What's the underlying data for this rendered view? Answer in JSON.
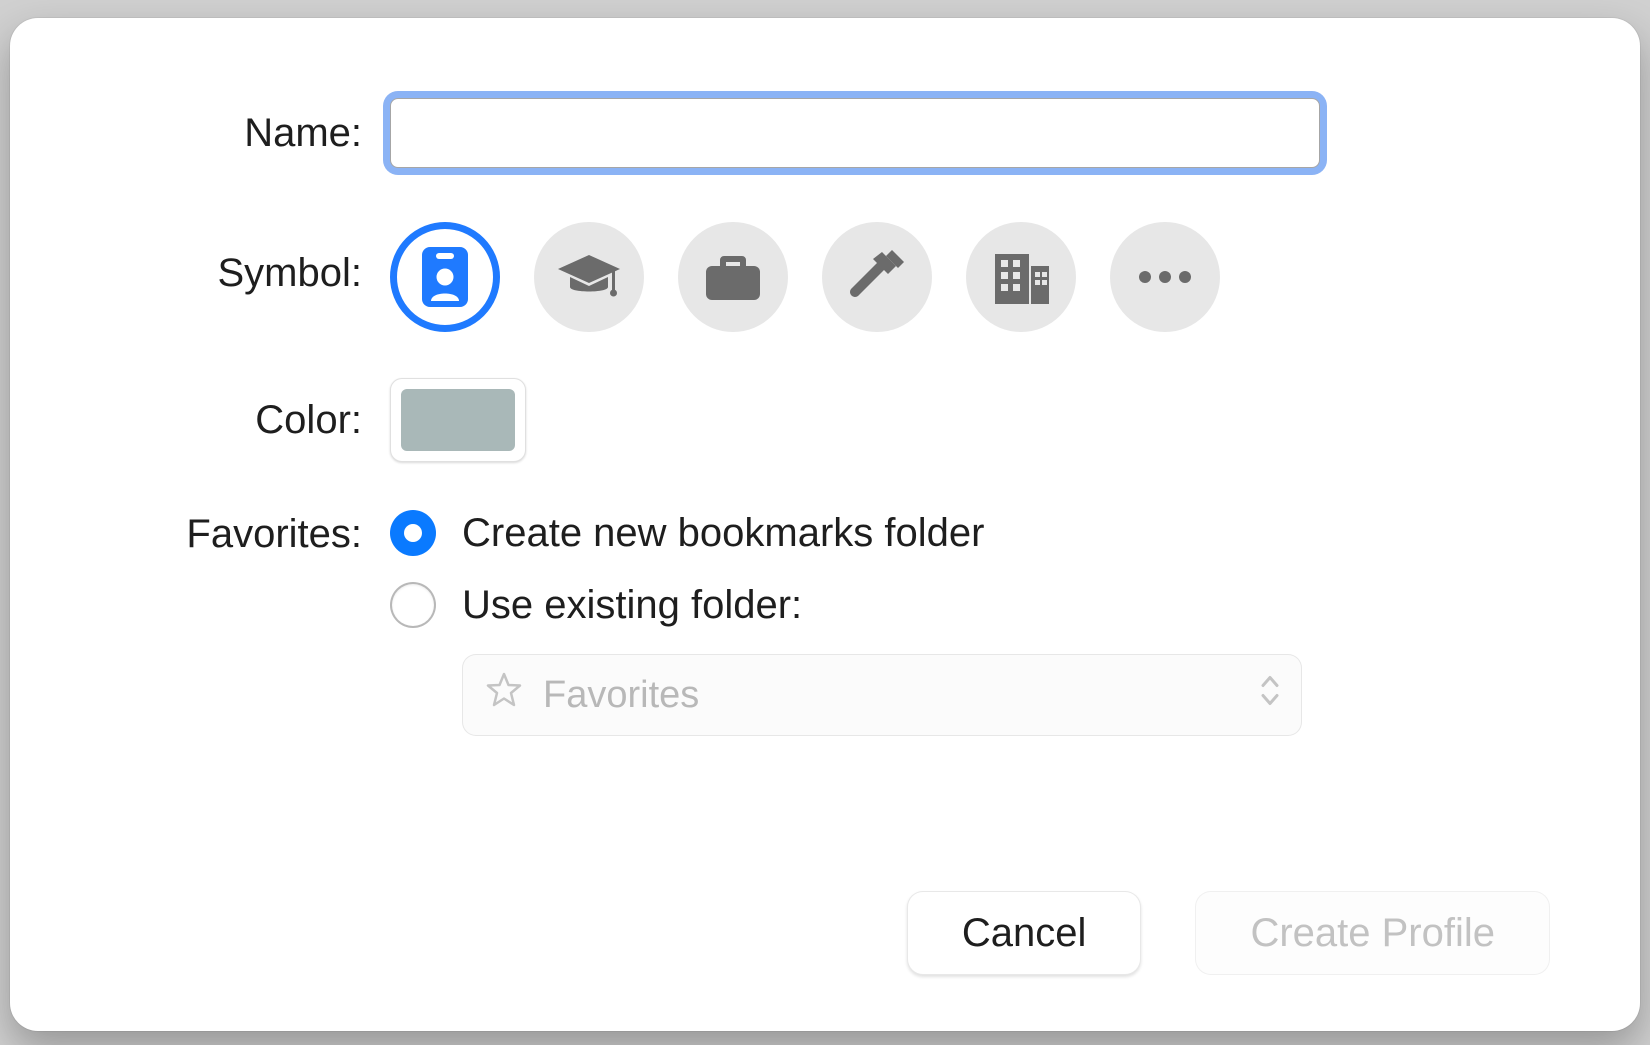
{
  "labels": {
    "name": "Name:",
    "symbol": "Symbol:",
    "color": "Color:",
    "favorites": "Favorites:"
  },
  "name_field": {
    "value": "",
    "placeholder": ""
  },
  "symbols": {
    "selected_index": 0,
    "options": [
      {
        "id": "badge",
        "name": "id-badge-icon"
      },
      {
        "id": "graduation",
        "name": "graduation-cap-icon"
      },
      {
        "id": "briefcase",
        "name": "briefcase-icon"
      },
      {
        "id": "hammer",
        "name": "hammer-icon"
      },
      {
        "id": "building",
        "name": "building-icon"
      },
      {
        "id": "more",
        "name": "ellipsis-icon"
      }
    ]
  },
  "color": {
    "swatch": "#a9b8b8"
  },
  "favorites": {
    "selected": "create_new",
    "options": {
      "create_new": "Create new bookmarks folder",
      "use_existing": "Use existing folder:"
    },
    "existing_folder_select": {
      "value": "Favorites",
      "disabled": true
    }
  },
  "buttons": {
    "cancel": "Cancel",
    "create_profile": "Create Profile",
    "create_profile_enabled": false
  }
}
